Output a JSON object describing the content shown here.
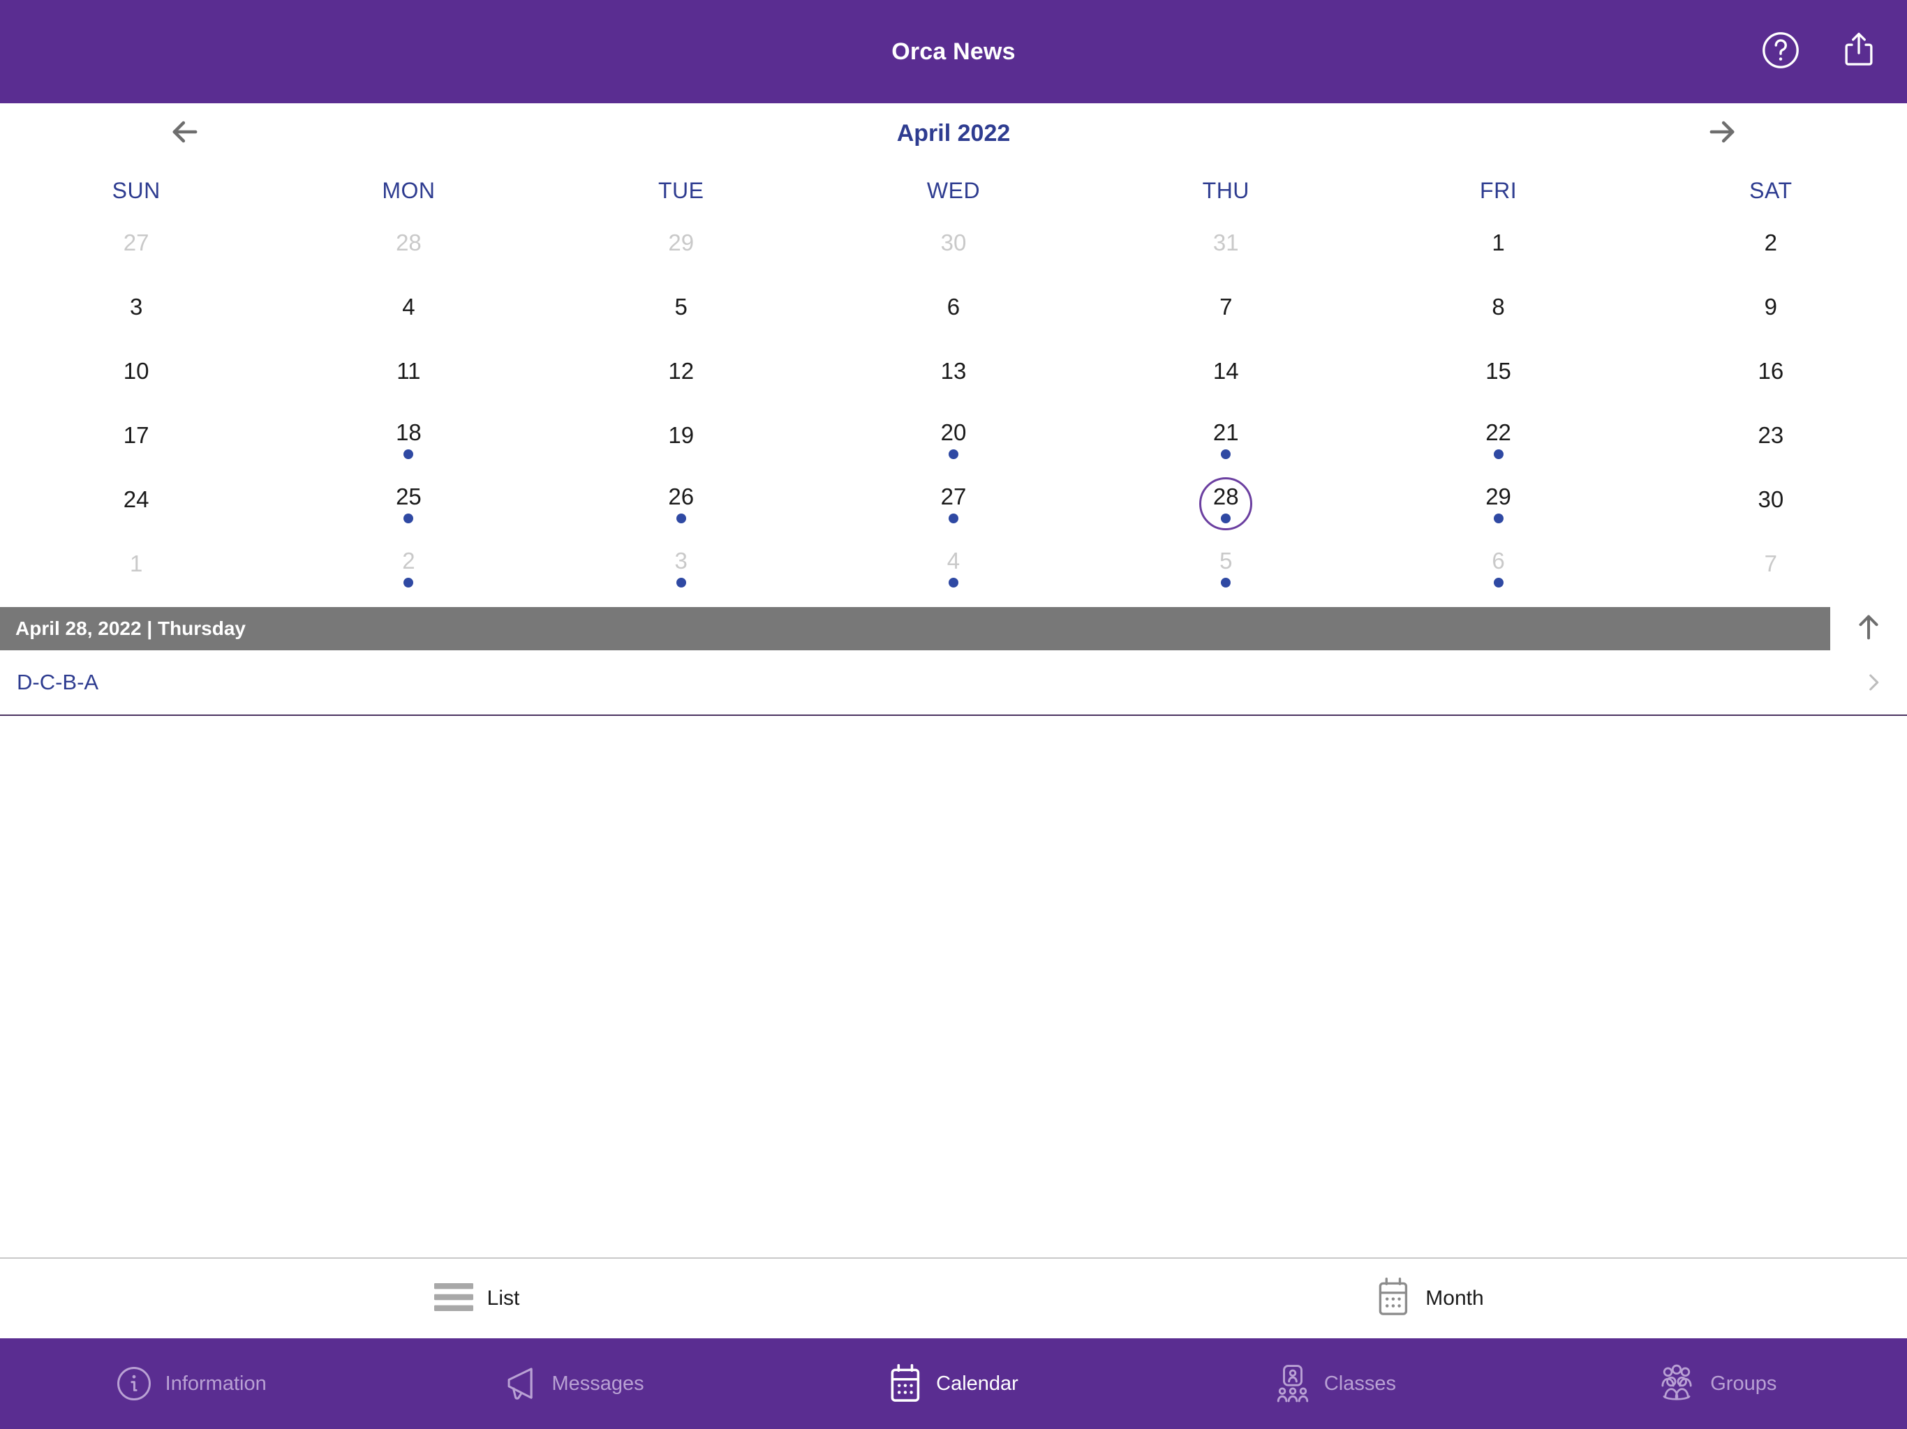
{
  "header": {
    "title": "Orca News",
    "help_icon": "question-circle-icon",
    "share_icon": "share-icon",
    "background_color": "#5A2D91"
  },
  "calendar": {
    "month_title": "April 2022",
    "prev_label": "←",
    "next_label": "→",
    "weekdays": [
      "SUN",
      "MON",
      "TUE",
      "WED",
      "THU",
      "FRI",
      "SAT"
    ],
    "accent_color": "#2E3C90",
    "dot_color": "#2F49A3",
    "selected_ring_color": "#6B3FA0",
    "weeks": [
      [
        {
          "num": "27",
          "muted": true,
          "dot": false,
          "selected": false
        },
        {
          "num": "28",
          "muted": true,
          "dot": false,
          "selected": false
        },
        {
          "num": "29",
          "muted": true,
          "dot": false,
          "selected": false
        },
        {
          "num": "30",
          "muted": true,
          "dot": false,
          "selected": false
        },
        {
          "num": "31",
          "muted": true,
          "dot": false,
          "selected": false
        },
        {
          "num": "1",
          "muted": false,
          "dot": false,
          "selected": false
        },
        {
          "num": "2",
          "muted": false,
          "dot": false,
          "selected": false
        }
      ],
      [
        {
          "num": "3",
          "muted": false,
          "dot": false,
          "selected": false
        },
        {
          "num": "4",
          "muted": false,
          "dot": false,
          "selected": false
        },
        {
          "num": "5",
          "muted": false,
          "dot": false,
          "selected": false
        },
        {
          "num": "6",
          "muted": false,
          "dot": false,
          "selected": false
        },
        {
          "num": "7",
          "muted": false,
          "dot": false,
          "selected": false
        },
        {
          "num": "8",
          "muted": false,
          "dot": false,
          "selected": false
        },
        {
          "num": "9",
          "muted": false,
          "dot": false,
          "selected": false
        }
      ],
      [
        {
          "num": "10",
          "muted": false,
          "dot": false,
          "selected": false
        },
        {
          "num": "11",
          "muted": false,
          "dot": false,
          "selected": false
        },
        {
          "num": "12",
          "muted": false,
          "dot": false,
          "selected": false
        },
        {
          "num": "13",
          "muted": false,
          "dot": false,
          "selected": false
        },
        {
          "num": "14",
          "muted": false,
          "dot": false,
          "selected": false
        },
        {
          "num": "15",
          "muted": false,
          "dot": false,
          "selected": false
        },
        {
          "num": "16",
          "muted": false,
          "dot": false,
          "selected": false
        }
      ],
      [
        {
          "num": "17",
          "muted": false,
          "dot": false,
          "selected": false
        },
        {
          "num": "18",
          "muted": false,
          "dot": true,
          "selected": false
        },
        {
          "num": "19",
          "muted": false,
          "dot": false,
          "selected": false
        },
        {
          "num": "20",
          "muted": false,
          "dot": true,
          "selected": false
        },
        {
          "num": "21",
          "muted": false,
          "dot": true,
          "selected": false
        },
        {
          "num": "22",
          "muted": false,
          "dot": true,
          "selected": false
        },
        {
          "num": "23",
          "muted": false,
          "dot": false,
          "selected": false
        }
      ],
      [
        {
          "num": "24",
          "muted": false,
          "dot": false,
          "selected": false
        },
        {
          "num": "25",
          "muted": false,
          "dot": true,
          "selected": false
        },
        {
          "num": "26",
          "muted": false,
          "dot": true,
          "selected": false
        },
        {
          "num": "27",
          "muted": false,
          "dot": true,
          "selected": false
        },
        {
          "num": "28",
          "muted": false,
          "dot": true,
          "selected": true
        },
        {
          "num": "29",
          "muted": false,
          "dot": true,
          "selected": false
        },
        {
          "num": "30",
          "muted": false,
          "dot": false,
          "selected": false
        }
      ],
      [
        {
          "num": "1",
          "muted": true,
          "dot": false,
          "selected": false
        },
        {
          "num": "2",
          "muted": true,
          "dot": true,
          "selected": false
        },
        {
          "num": "3",
          "muted": true,
          "dot": true,
          "selected": false
        },
        {
          "num": "4",
          "muted": true,
          "dot": true,
          "selected": false
        },
        {
          "num": "5",
          "muted": true,
          "dot": true,
          "selected": false
        },
        {
          "num": "6",
          "muted": true,
          "dot": true,
          "selected": false
        },
        {
          "num": "7",
          "muted": true,
          "dot": false,
          "selected": false
        }
      ]
    ]
  },
  "day_bar": {
    "text": "April 28, 2022 | Thursday",
    "background_color": "#787878",
    "collapse_icon": "arrow-up-icon"
  },
  "events": [
    {
      "title": "D-C-B-A",
      "chevron": "chevron-right-icon"
    }
  ],
  "view_switch": {
    "options": [
      {
        "label": "List",
        "icon": "list-icon",
        "active": false
      },
      {
        "label": "Month",
        "icon": "calendar-icon",
        "active": true
      }
    ]
  },
  "tabbar": {
    "background_color": "#5A2D91",
    "active_color": "#FFFFFF",
    "inactive_color": "#B9A1D4",
    "items": [
      {
        "label": "Information",
        "icon": "info-circle-icon",
        "active": false
      },
      {
        "label": "Messages",
        "icon": "megaphone-icon",
        "active": false
      },
      {
        "label": "Calendar",
        "icon": "calendar-icon",
        "active": true
      },
      {
        "label": "Classes",
        "icon": "classes-icon",
        "active": false
      },
      {
        "label": "Groups",
        "icon": "groups-icon",
        "active": false
      }
    ]
  }
}
